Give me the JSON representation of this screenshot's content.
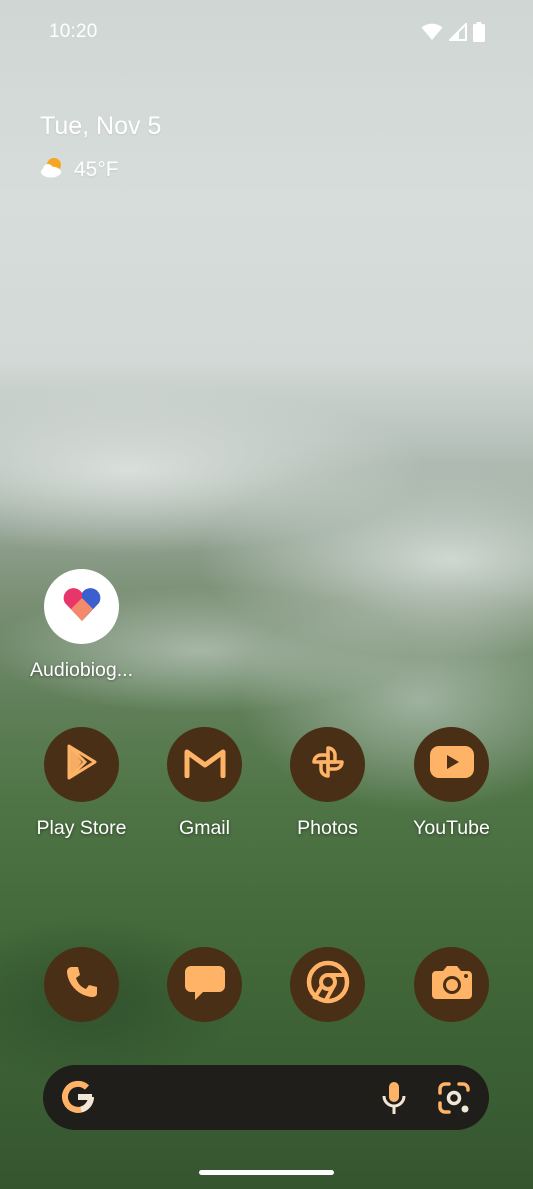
{
  "status_bar": {
    "time": "10:20",
    "icons": [
      "wifi-icon",
      "cellular-signal-icon",
      "battery-icon"
    ]
  },
  "date_widget": {
    "date": "Tue, Nov 5",
    "weather_icon": "partly-cloudy-icon",
    "temperature": "45°F"
  },
  "standalone_apps": [
    {
      "label": "Audiobiog...",
      "icon": "heart-icon"
    }
  ],
  "app_row": [
    {
      "label": "Play Store",
      "icon": "play-store-icon"
    },
    {
      "label": "Gmail",
      "icon": "gmail-icon"
    },
    {
      "label": "Photos",
      "icon": "photos-pinwheel-icon"
    },
    {
      "label": "YouTube",
      "icon": "youtube-icon"
    }
  ],
  "dock": [
    {
      "name": "Phone",
      "icon": "phone-icon"
    },
    {
      "name": "Messages",
      "icon": "messages-icon"
    },
    {
      "name": "Chrome",
      "icon": "chrome-icon"
    },
    {
      "name": "Camera",
      "icon": "camera-icon"
    }
  ],
  "search_bar": {
    "logo": "google-g-icon",
    "actions": [
      "microphone-icon",
      "google-lens-icon"
    ]
  },
  "colors": {
    "icon_background": "#4a2f17",
    "icon_foreground": "#ffb366",
    "search_bar_background": "#1f1e1a"
  }
}
